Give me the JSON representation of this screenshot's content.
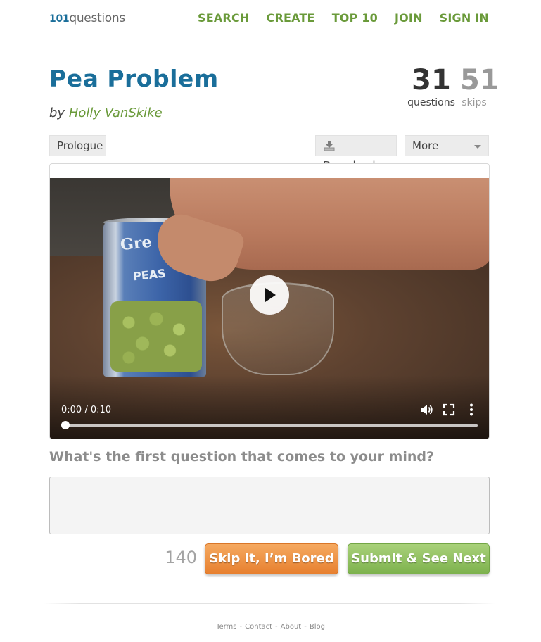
{
  "header": {
    "logo_num": "101",
    "logo_word": "questions",
    "nav": [
      "SEARCH",
      "CREATE",
      "TOP 10",
      "JOIN",
      "SIGN IN"
    ]
  },
  "page": {
    "title": "Pea Problem",
    "by": "by",
    "author": "Holly VanSkike"
  },
  "stats": {
    "questions_count": "31",
    "questions_label": "questions",
    "skips_count": "51",
    "skips_label": "skips"
  },
  "toolbar": {
    "prologue": "Prologue",
    "download": "Download",
    "more": "More"
  },
  "video": {
    "time": "0:00 / 0:10",
    "can_text_1": "Gre",
    "can_text_2": "PEAS",
    "progress": 0
  },
  "question": {
    "prompt": "What's the first question that comes to your mind?",
    "input_value": "",
    "char_count": "140"
  },
  "actions": {
    "skip": "Skip It, I’m Bored",
    "submit": "Submit & See Next"
  },
  "footer": {
    "links": [
      "Terms",
      "Contact",
      "About",
      "Blog"
    ],
    "separator": "-"
  },
  "colors": {
    "brand_blue": "#1a6e9a",
    "nav_green": "#6a9a3a",
    "skip_orange": "#e7802f",
    "submit_green": "#7db24d"
  }
}
